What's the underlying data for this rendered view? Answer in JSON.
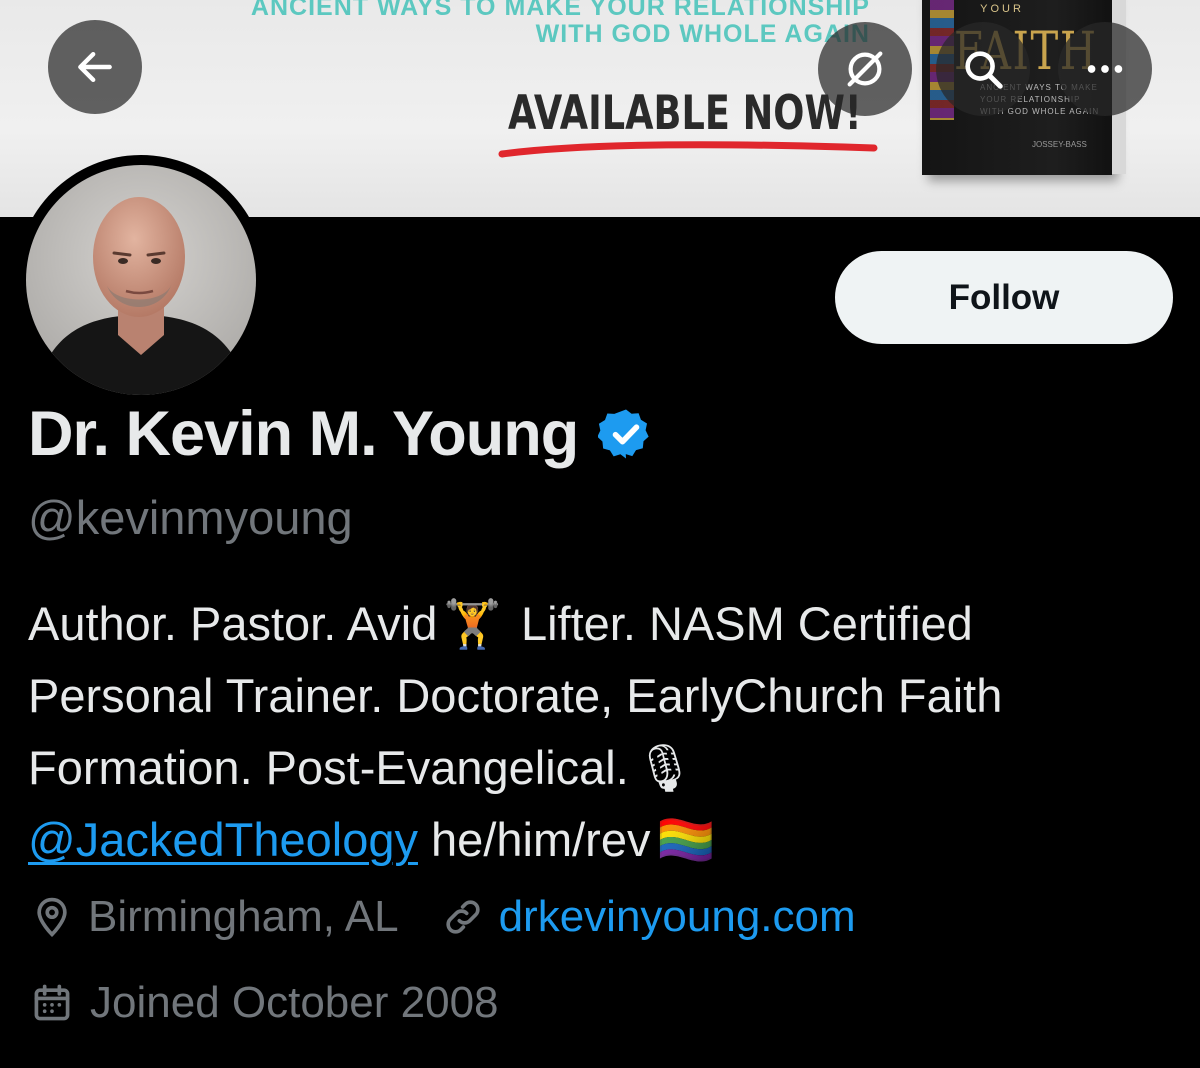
{
  "banner": {
    "tagline_line1": "ANCIENT WAYS TO MAKE YOUR RELATIONSHIP",
    "tagline_line2": "WITH GOD WHOLE AGAIN",
    "cta": "AVAILABLE NOW!",
    "book": {
      "title_top": "YOUR",
      "title_main": "FAITH",
      "subtitle": "ANCIENT WAYS TO MAKE YOUR RELATIONSHIP WITH GOD WHOLE AGAIN",
      "publisher": "JOSSEY-BASS"
    }
  },
  "toolbar": {
    "back_icon": "arrow-left-icon",
    "grok_icon": "slashed-circle-icon",
    "search_icon": "search-icon",
    "more_icon": "more-horizontal-icon"
  },
  "profile": {
    "display_name": "Dr. Kevin M. Young",
    "handle": "@kevinmyoung",
    "verified_icon": "verified-badge-icon",
    "follow_label": "Follow",
    "bio": {
      "line1_a": "Author. Pastor. Avid",
      "line1_b": " Lifter. NASM Certified",
      "line2": "Personal Trainer. Doctorate, EarlyChurch Faith",
      "line3": "Formation. Post-Evangelical.",
      "mention": "@JackedTheology",
      "pronouns": " he/him/rev",
      "emoji_lifter": "🏋",
      "emoji_mic": "🎙",
      "emoji_flag": "🏳️‍🌈"
    },
    "location": "Birmingham, AL",
    "website": "drkevinyoung.com",
    "joined": "Joined October 2008"
  },
  "colors": {
    "background": "#000000",
    "text": "#e7e9ea",
    "muted": "#71767b",
    "accent": "#1d9bf0",
    "follow_bg": "#eff3f4"
  }
}
